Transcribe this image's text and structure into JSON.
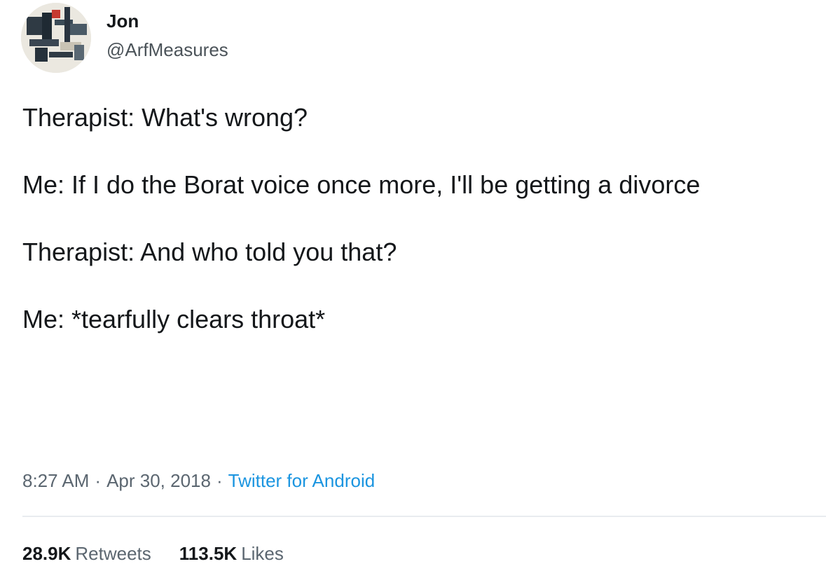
{
  "tweet": {
    "author": {
      "display_name": "Jon",
      "handle": "@ArfMeasures"
    },
    "lines": [
      "Therapist: What's wrong?",
      "Me: If I do the Borat voice once more, I'll be getting a divorce",
      "Therapist: And who told you that?",
      "Me: *tearfully clears throat*"
    ],
    "meta": {
      "time": "8:27 AM",
      "separator": "·",
      "date": "Apr 30, 2018",
      "source": "Twitter for Android"
    },
    "stats": {
      "retweets_count": "28.9K",
      "retweets_label": "Retweets",
      "likes_count": "113.5K",
      "likes_label": "Likes"
    }
  },
  "colors": {
    "text_primary": "#14171a",
    "text_secondary": "#5b6670",
    "link": "#1b95e0",
    "divider": "#e9ecef"
  },
  "icons": {
    "avatar": "profile-picture"
  }
}
